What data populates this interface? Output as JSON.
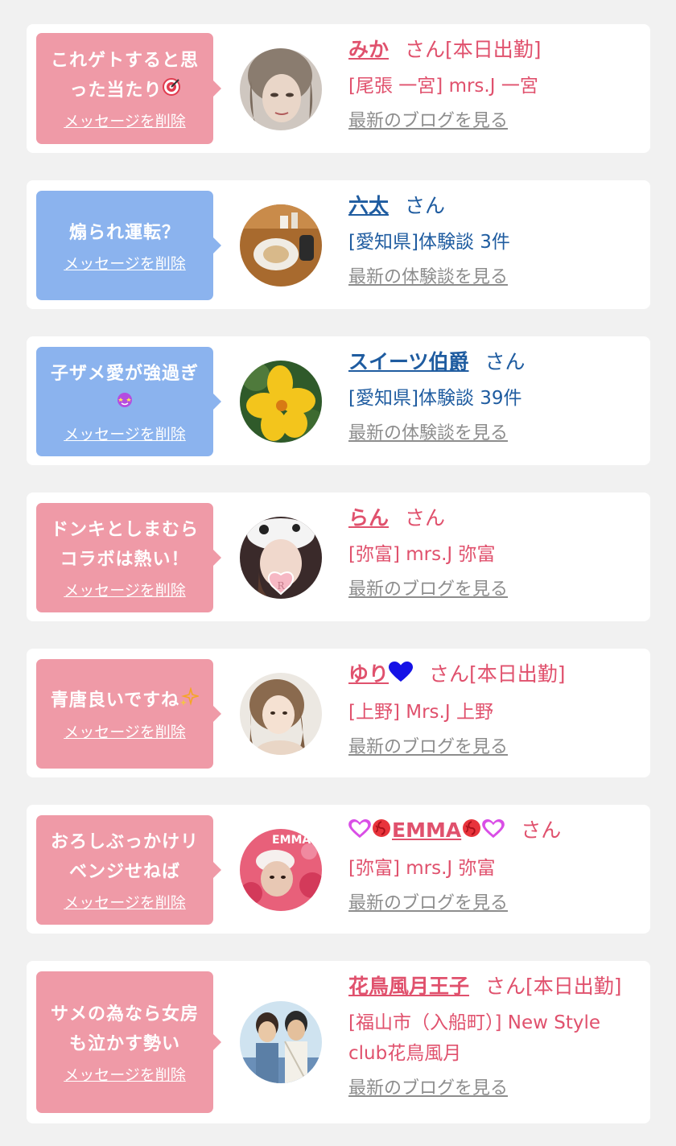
{
  "colors": {
    "bubble_pink": "#ef9aa7",
    "bubble_blue": "#8bb3ee",
    "name_pink": "#e0516d",
    "name_blue": "#1f5ca0",
    "link_gray": "#8d8d8d",
    "background": "#f1f1f1"
  },
  "delete_label": "メッセージを削除",
  "honorific": "さん",
  "cards": [
    {
      "message": "これゲトすると思った当たり",
      "message_icon": "bullseye-icon",
      "name": "みか",
      "status": "[本日出勤]",
      "shop": "[尾張 一宮] mrs.J 一宮",
      "link": "最新のブログを見る"
    },
    {
      "message": "煽られ運転？",
      "name": "六太",
      "status": "",
      "shop": "[愛知県]体験談 3件",
      "link": "最新の体験談を見る"
    },
    {
      "message": "子ザメ愛が強過ぎ",
      "message_icon": "star-struck-face-icon",
      "name": "スイーツ伯爵",
      "status": "",
      "shop": "[愛知県]体験談 39件",
      "link": "最新の体験談を見る"
    },
    {
      "message": "ドンキとしまむらコラボは熱い！",
      "name": "らん",
      "status": "",
      "shop": "[弥富] mrs.J 弥富",
      "link": "最新のブログを見る"
    },
    {
      "message": "青唐良いですね",
      "message_icon": "sparkles-icon",
      "name": "ゆり",
      "name_icon": "blue-heart-icon",
      "status": "[本日出勤]",
      "shop": "[上野] Mrs.J 上野",
      "link": "最新のブログを見る"
    },
    {
      "message": "おろしぶっかけリベンジせねば",
      "name": "EMMA",
      "name_icons": [
        "purple-heart-icon",
        "rose-icon",
        "rose-icon",
        "purple-heart-icon"
      ],
      "status": "",
      "shop": "[弥富] mrs.J 弥富",
      "link": "最新のブログを見る"
    },
    {
      "message": "サメの為なら女房も泣かす勢い",
      "name": "花鳥風月王子",
      "status": "[本日出勤]",
      "shop": "[福山市（入船町）] New Style club花鳥風月",
      "link": "最新のブログを見る"
    }
  ]
}
